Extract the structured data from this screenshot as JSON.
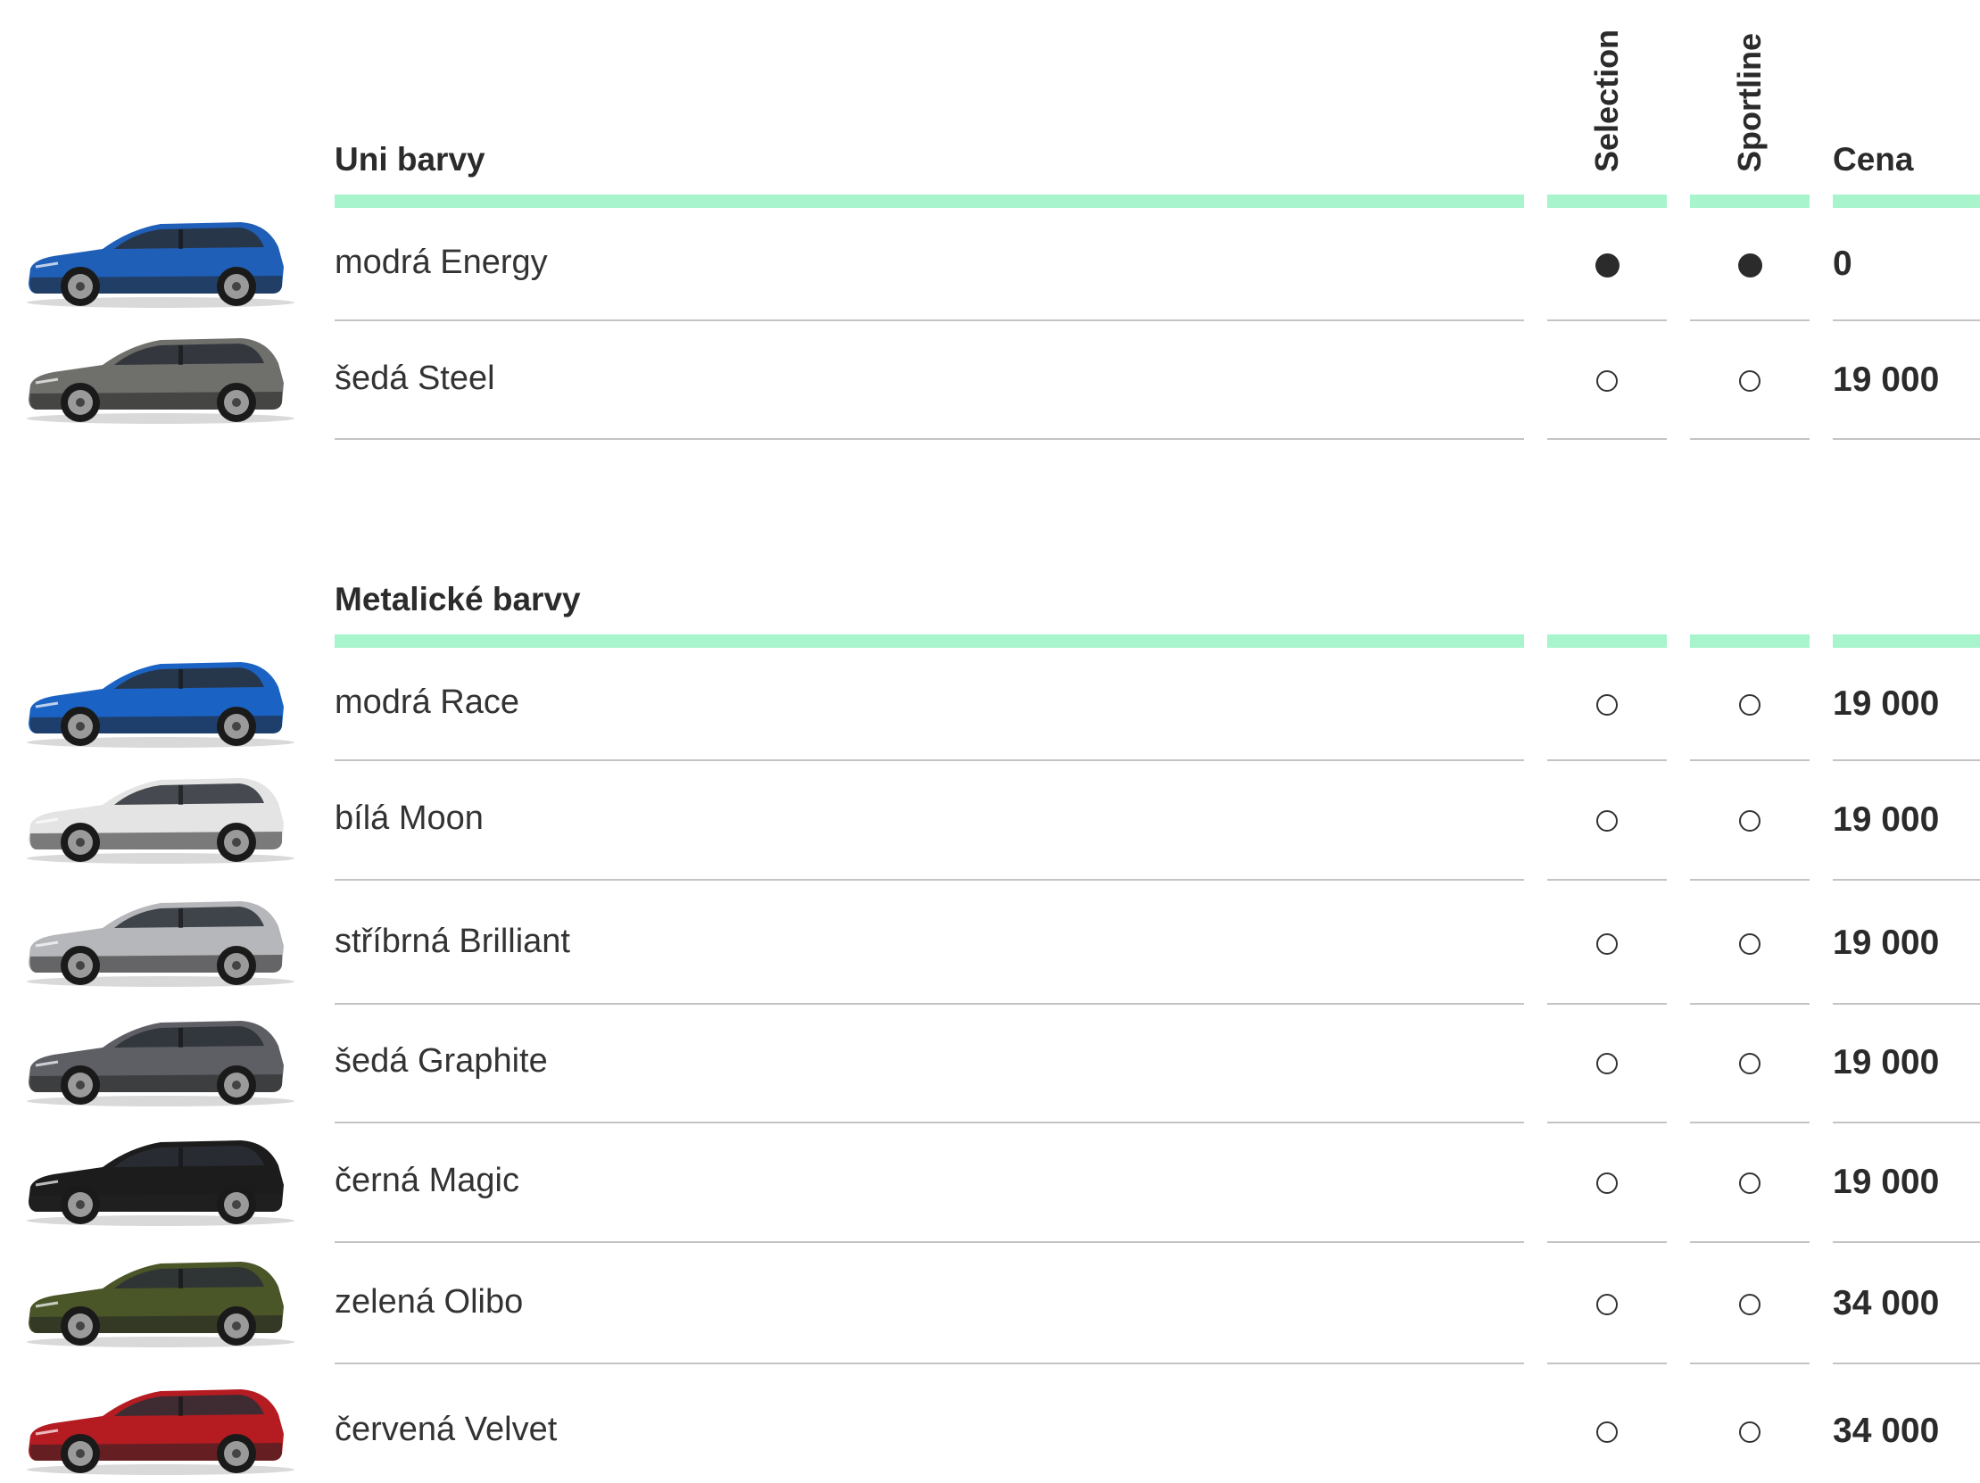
{
  "columns": {
    "selection": "Selection",
    "sportline": "Sportline",
    "price": "Cena"
  },
  "colors": {
    "accent": "#a7f4cd"
  },
  "sections": [
    {
      "title": "Uni barvy",
      "rows": [
        {
          "name": "modrá Energy",
          "selection": "standard",
          "sportline": "standard",
          "price": "0",
          "car_color": "#1f5fb8"
        },
        {
          "name": "šedá Steel",
          "selection": "optional",
          "sportline": "optional",
          "price": "19 000",
          "car_color": "#6f6f6c"
        }
      ]
    },
    {
      "title": "Metalické barvy",
      "rows": [
        {
          "name": "modrá Race",
          "selection": "optional",
          "sportline": "optional",
          "price": "19 000",
          "car_color": "#1a63c4"
        },
        {
          "name": "bílá Moon",
          "selection": "optional",
          "sportline": "optional",
          "price": "19 000",
          "car_color": "#e4e4e4"
        },
        {
          "name": "stříbrná Brilliant",
          "selection": "optional",
          "sportline": "optional",
          "price": "19 000",
          "car_color": "#b5b7ba"
        },
        {
          "name": "šedá Graphite",
          "selection": "optional",
          "sportline": "optional",
          "price": "19 000",
          "car_color": "#5d5f64"
        },
        {
          "name": "černá Magic",
          "selection": "optional",
          "sportline": "optional",
          "price": "19 000",
          "car_color": "#1c1c1c"
        },
        {
          "name": "zelená Olibo",
          "selection": "optional",
          "sportline": "optional",
          "price": "34 000",
          "car_color": "#4a5528"
        },
        {
          "name": "červená Velvet",
          "selection": "optional",
          "sportline": "optional",
          "price": "34 000",
          "car_color": "#b51c22"
        }
      ]
    }
  ]
}
